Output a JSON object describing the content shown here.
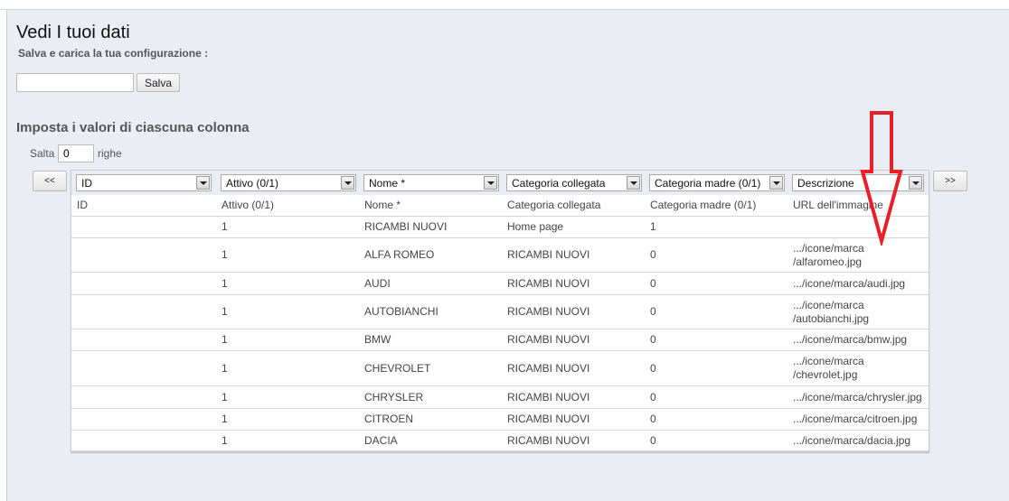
{
  "title": "Vedi I tuoi dati",
  "subtitle": "Salva e carica la tua configurazione :",
  "config_input": {
    "value": "",
    "placeholder": ""
  },
  "save_label": "Salva",
  "section_title": "Imposta i valori di ciascuna colonna",
  "skip": {
    "label_before": "Salta",
    "value": "0",
    "label_after": "righe"
  },
  "prev_label": "<<",
  "next_label": ">>",
  "column_selects": [
    "ID",
    "Attivo (0/1)",
    "Nome *",
    "Categoria collegata",
    "Categoria madre (0/1)",
    "Descrizione"
  ],
  "headers": [
    "ID",
    "Attivo (0/1)",
    "Nome *",
    "Categoria collegata",
    "Categoria madre (0/1)",
    "URL dell'immagine"
  ],
  "rows": [
    [
      "",
      "1",
      "RICAMBI NUOVI",
      "Home page",
      "1",
      ""
    ],
    [
      "",
      "1",
      "ALFA ROMEO",
      "RICAMBI NUOVI",
      "0",
      ".../icone/marca\n/alfaromeo.jpg"
    ],
    [
      "",
      "1",
      "AUDI",
      "RICAMBI NUOVI",
      "0",
      ".../icone/marca/audi.jpg"
    ],
    [
      "",
      "1",
      "AUTOBIANCHI",
      "RICAMBI NUOVI",
      "0",
      ".../icone/marca\n/autobianchi.jpg"
    ],
    [
      "",
      "1",
      "BMW",
      "RICAMBI NUOVI",
      "0",
      ".../icone/marca/bmw.jpg"
    ],
    [
      "",
      "1",
      "CHEVROLET",
      "RICAMBI NUOVI",
      "0",
      ".../icone/marca\n/chevrolet.jpg"
    ],
    [
      "",
      "1",
      "CHRYSLER",
      "RICAMBI NUOVI",
      "0",
      ".../icone/marca/chrysler.jpg"
    ],
    [
      "",
      "1",
      "CITROEN",
      "RICAMBI NUOVI",
      "0",
      ".../icone/marca/citroen.jpg"
    ],
    [
      "",
      "1",
      "DACIA",
      "RICAMBI NUOVI",
      "0",
      ".../icone/marca/dacia.jpg"
    ]
  ],
  "annotation": {
    "icon": "red-down-arrow-icon",
    "color": "#e8202a"
  }
}
